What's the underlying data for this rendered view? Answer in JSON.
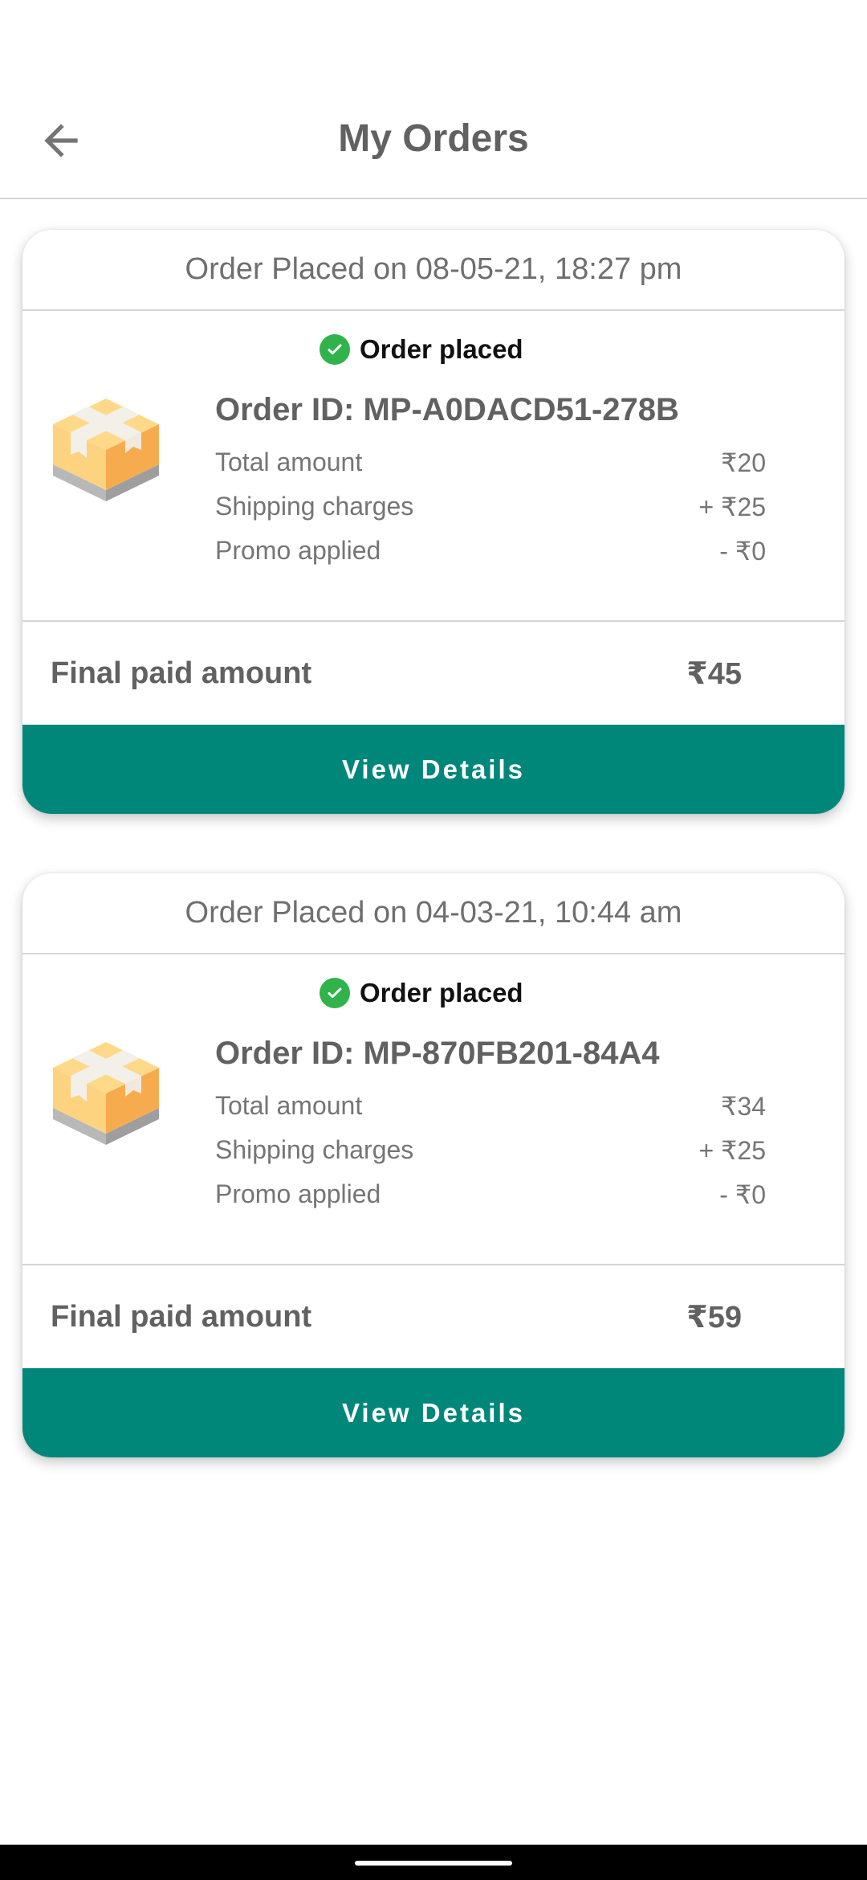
{
  "header": {
    "title": "My Orders",
    "back_icon": "arrow-left-icon"
  },
  "orders": [
    {
      "placed_on": "Order Placed on 08-05-21, 18:27 pm",
      "status": "Order placed",
      "order_id": "Order ID: MP-A0DACD51-278B",
      "rows": [
        {
          "label": "Total amount",
          "value": "₹20"
        },
        {
          "label": "Shipping charges",
          "value": "+ ₹25"
        },
        {
          "label": "Promo applied",
          "value": "- ₹0"
        }
      ],
      "final_label": "Final paid amount",
      "final_value": "₹45",
      "button_label": "View Details"
    },
    {
      "placed_on": "Order Placed on 04-03-21, 10:44 am",
      "status": "Order placed",
      "order_id": "Order ID: MP-870FB201-84A4",
      "rows": [
        {
          "label": "Total amount",
          "value": "₹34"
        },
        {
          "label": "Shipping charges",
          "value": "+ ₹25"
        },
        {
          "label": "Promo applied",
          "value": "- ₹0"
        }
      ],
      "final_label": "Final paid amount",
      "final_value": "₹59",
      "button_label": "View Details"
    }
  ],
  "colors": {
    "accent": "#00877a",
    "status_green": "#2fb34a",
    "title_gray": "#616161",
    "text_gray": "#757575"
  }
}
